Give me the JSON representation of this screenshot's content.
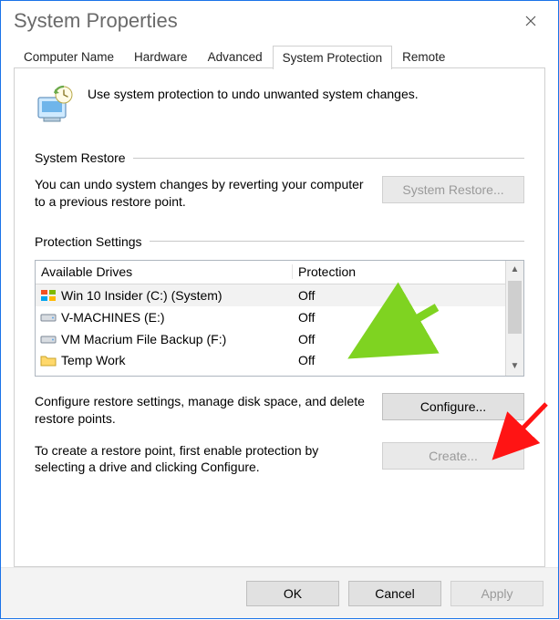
{
  "window": {
    "title": "System Properties"
  },
  "tabs": [
    {
      "label": "Computer Name"
    },
    {
      "label": "Hardware"
    },
    {
      "label": "Advanced"
    },
    {
      "label": "System Protection"
    },
    {
      "label": "Remote"
    }
  ],
  "intro": "Use system protection to undo unwanted system changes.",
  "restore": {
    "title": "System Restore",
    "desc": "You can undo system changes by reverting your computer to a previous restore point.",
    "button": "System Restore..."
  },
  "protection": {
    "title": "Protection Settings",
    "headers": {
      "drives": "Available Drives",
      "status": "Protection"
    },
    "drives": [
      {
        "name": "Win 10 Insider (C:) (System)",
        "status": "Off",
        "icon": "win"
      },
      {
        "name": "V-MACHINES (E:)",
        "status": "Off",
        "icon": "hdd"
      },
      {
        "name": "VM Macrium File Backup (F:)",
        "status": "Off",
        "icon": "hdd"
      },
      {
        "name": "Temp Work",
        "status": "Off",
        "icon": "folder"
      }
    ],
    "configure_desc": "Configure restore settings, manage disk space, and delete restore points.",
    "configure_btn": "Configure...",
    "create_desc": "To create a restore point, first enable protection by selecting a drive and clicking Configure.",
    "create_btn": "Create..."
  },
  "footer": {
    "ok": "OK",
    "cancel": "Cancel",
    "apply": "Apply"
  }
}
